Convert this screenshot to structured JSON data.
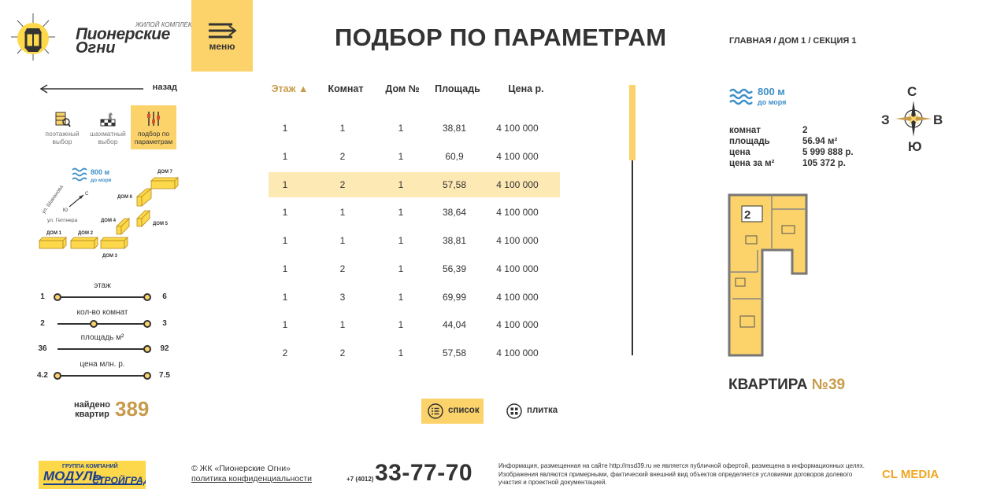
{
  "brand": {
    "subtitle": "ЖИЛОЙ КОМПЛЕКС",
    "name_line1": "Пионерские",
    "name_line2": "Огни"
  },
  "menu": {
    "label": "меню"
  },
  "page_title": "ПОДБОР ПО ПАРАМЕТРАМ",
  "breadcrumb": "ГЛАВНАЯ / ДОМ 1 / СЕКЦИЯ 1",
  "back_label": "назад",
  "modes": [
    {
      "label_line1": "поэтажный",
      "label_line2": "выбор"
    },
    {
      "label_line1": "шахматный",
      "label_line2": "выбор"
    },
    {
      "label_line1": "подбор по",
      "label_line2": "параметрам"
    }
  ],
  "minimap": {
    "sea_distance": "800 м",
    "sea_sub": "до моря",
    "street1": "ул. Шаманова",
    "street2": "ул. Гептнера",
    "north": "С",
    "south": "Ю",
    "houses": [
      "ДОМ 1",
      "ДОМ 2",
      "ДОМ 3",
      "ДОМ 4",
      "ДОМ 5",
      "ДОМ 6",
      "ДОМ 7"
    ]
  },
  "filters": [
    {
      "label": "этаж",
      "min": "1",
      "max": "6",
      "knob_min": 0.0,
      "knob_max": 1.0
    },
    {
      "label": "кол-во комнат",
      "min": "2",
      "max": "3",
      "knob_min": 0.4,
      "knob_max": 1.0
    },
    {
      "label": "площадь м²",
      "min": "36",
      "max": "92",
      "knob_min": 1.0,
      "knob_max": 1.0
    },
    {
      "label": "цена млн. р.",
      "min": "4.2",
      "max": "7.5",
      "knob_min": 0.0,
      "knob_max": 1.0
    }
  ],
  "found": {
    "label_line1": "найдено",
    "label_line2": "квартир",
    "count": "389"
  },
  "table": {
    "headers": [
      "Этаж ▲",
      "Комнат",
      "Дом №",
      "Площадь",
      "Цена р."
    ],
    "rows": [
      [
        "1",
        "1",
        "1",
        "38,81",
        "4 100 000"
      ],
      [
        "1",
        "2",
        "1",
        "60,9",
        "4 100 000"
      ],
      [
        "1",
        "2",
        "1",
        "57,58",
        "4 100 000"
      ],
      [
        "1",
        "1",
        "1",
        "38,64",
        "4 100 000"
      ],
      [
        "1",
        "1",
        "1",
        "38,81",
        "4 100 000"
      ],
      [
        "1",
        "2",
        "1",
        "56,39",
        "4 100 000"
      ],
      [
        "1",
        "3",
        "1",
        "69,99",
        "4 100 000"
      ],
      [
        "1",
        "1",
        "1",
        "44,04",
        "4 100 000"
      ],
      [
        "2",
        "2",
        "1",
        "57,58",
        "4 100 000"
      ]
    ]
  },
  "view_buttons": {
    "list": "список",
    "tile": "плитка"
  },
  "apartment": {
    "sea_distance": "800 м",
    "sea_sub": "до моря",
    "compass": {
      "n": "С",
      "s": "Ю",
      "w": "З",
      "e": "В"
    },
    "params": [
      {
        "k": "комнат",
        "v": "2"
      },
      {
        "k": "площадь",
        "v": "56.94 м²"
      },
      {
        "k": "цена",
        "v": "5 999 888 р."
      },
      {
        "k": "цена за м²",
        "v": "105 372 р."
      }
    ],
    "plan_rooms": "2",
    "title": "КВАРТИРА ",
    "number": "№39"
  },
  "footer": {
    "partner": "ГРУППА КОМПАНИЙ МОДУЛЬ СТРОЙГРАД",
    "partner_top": "ГРУППА КОМПАНИЙ",
    "partner_main": "МОДУЛЬ",
    "partner_sub": "СТРОЙГРАД",
    "copyright": "© ЖК «Пионерские Огни»",
    "privacy": "политика конфиденциальности",
    "phone_code": "+7 (4012)",
    "phone": "33-77-70",
    "disclaimer": "Информация, размещенная на сайте http://msd39.ru не является публичной офертой, размещена в информационных целях. Изображения являются примерными, фактический внешний вид объектов определяется условиями договоров долевого участия и проектной документацией.",
    "agency": "CL MEDIA"
  },
  "colors": {
    "accent": "#fcd36a",
    "gold": "#c89b4a",
    "sea": "#3e8fc8",
    "row_selected": "#fde9b4"
  }
}
